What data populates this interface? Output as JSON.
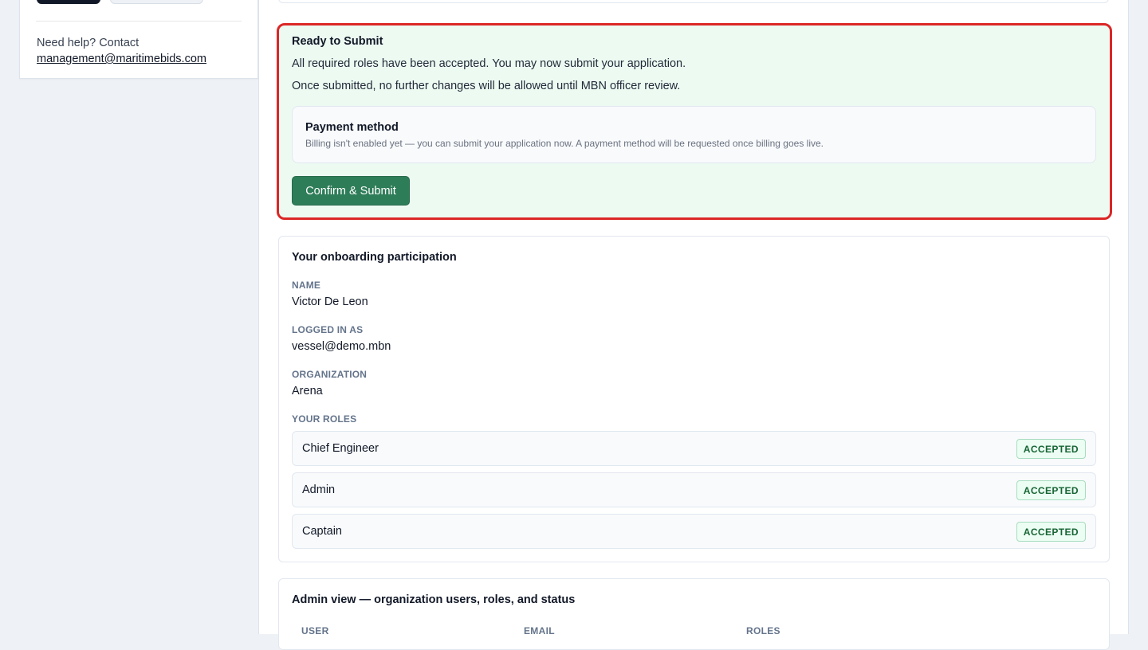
{
  "sidebar": {
    "help_text": "Need help? Contact",
    "help_email": "management@maritimebids.com"
  },
  "submit_panel": {
    "title": "Ready to Submit",
    "line1": "All required roles have been accepted. You may now submit your application.",
    "line2": "Once submitted, no further changes will be allowed until MBN officer review.",
    "payment": {
      "title": "Payment method",
      "description": "Billing isn't enabled yet — you can submit your application now. A payment method will be requested once billing goes live."
    },
    "confirm_label": "Confirm & Submit"
  },
  "participation": {
    "title": "Your onboarding participation",
    "name_label": "NAME",
    "name_value": "Victor De Leon",
    "login_label": "LOGGED IN AS",
    "login_value": "vessel@demo.mbn",
    "org_label": "ORGANIZATION",
    "org_value": "Arena",
    "roles_label": "YOUR ROLES",
    "roles": [
      {
        "name": "Chief Engineer",
        "status": "ACCEPTED"
      },
      {
        "name": "Admin",
        "status": "ACCEPTED"
      },
      {
        "name": "Captain",
        "status": "ACCEPTED"
      }
    ]
  },
  "admin_view": {
    "title": "Admin view — organization users, roles, and status",
    "columns": [
      "USER",
      "EMAIL",
      "ROLES"
    ]
  },
  "colors": {
    "highlight_border": "#dc2626",
    "success_bg": "#edfaf2",
    "primary_button": "#2e7d59",
    "badge_text": "#166534"
  }
}
